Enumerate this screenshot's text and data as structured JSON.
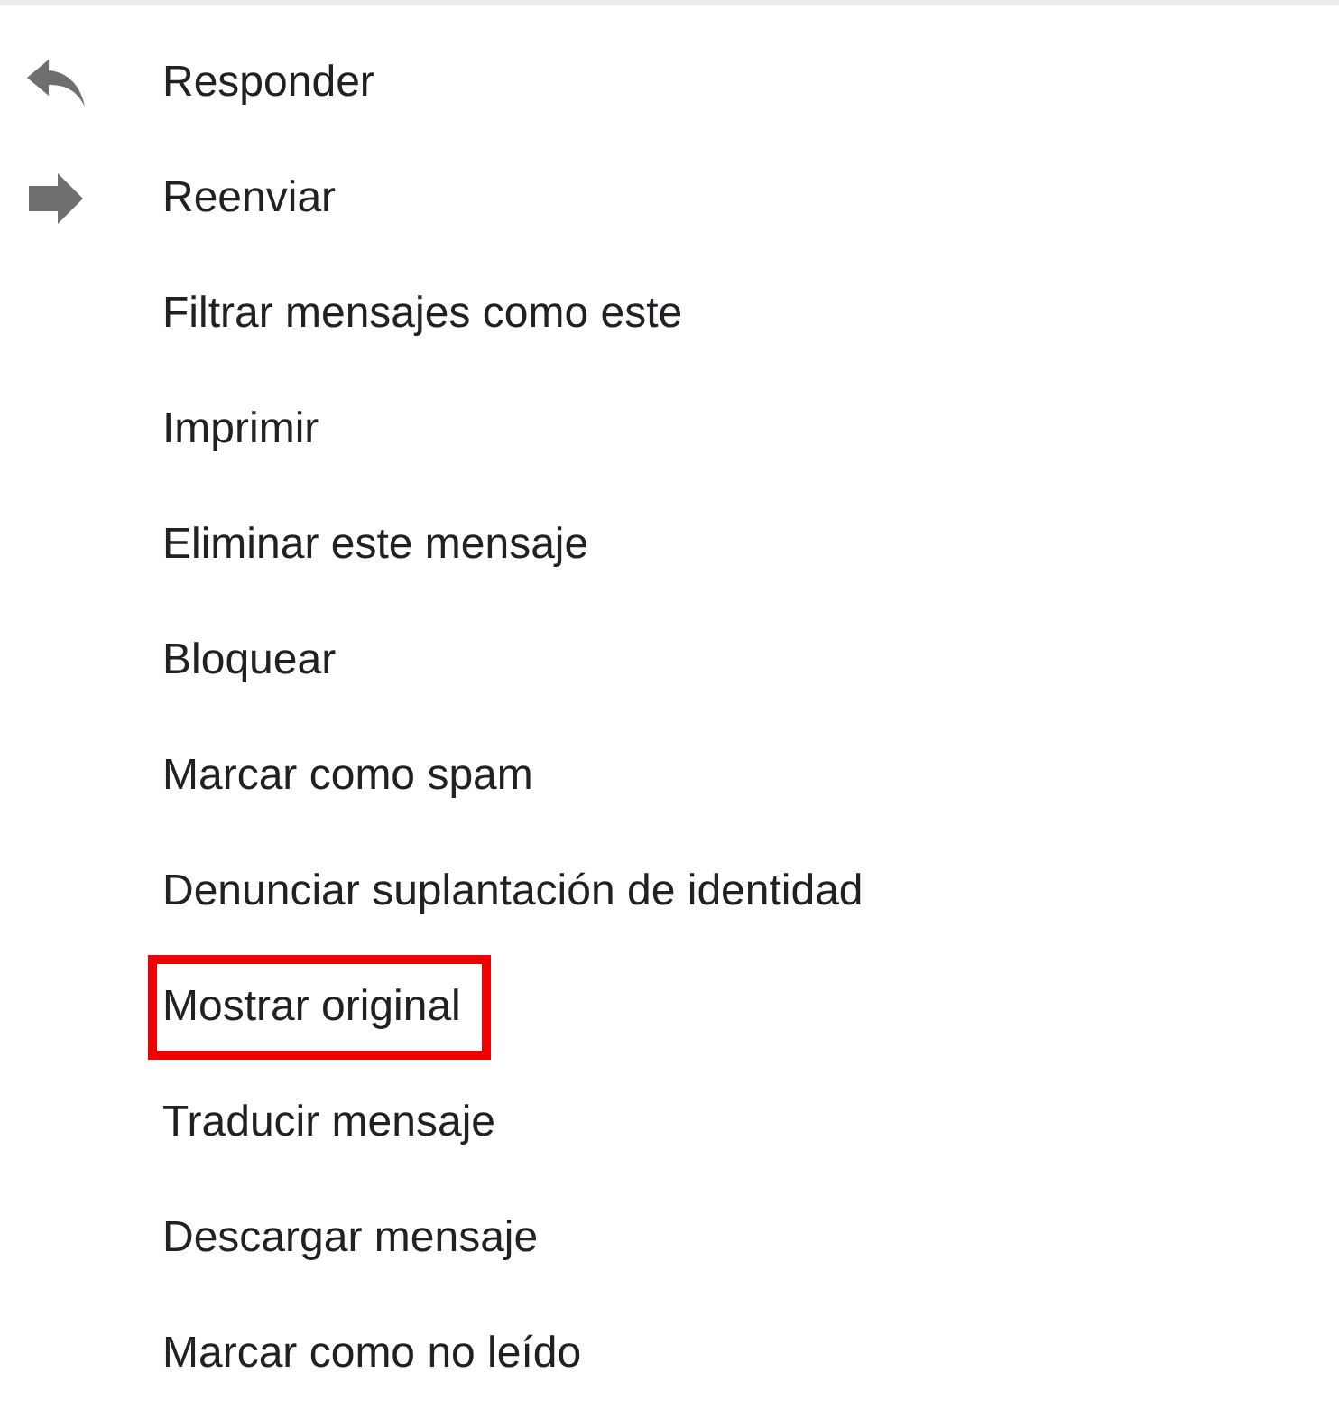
{
  "menu": {
    "items": [
      {
        "label": "Responder",
        "kind": "reply",
        "highlighted": false
      },
      {
        "label": "Reenviar",
        "kind": "forward",
        "highlighted": false
      },
      {
        "label": "Filtrar mensajes como este",
        "kind": "plain",
        "highlighted": false
      },
      {
        "label": "Imprimir",
        "kind": "plain",
        "highlighted": false
      },
      {
        "label": "Eliminar este mensaje",
        "kind": "plain",
        "highlighted": false
      },
      {
        "label": "Bloquear",
        "kind": "plain",
        "highlighted": false
      },
      {
        "label": "Marcar como spam",
        "kind": "plain",
        "highlighted": false
      },
      {
        "label": "Denunciar suplantación de identidad",
        "kind": "plain",
        "highlighted": false
      },
      {
        "label": "Mostrar original",
        "kind": "plain",
        "highlighted": true
      },
      {
        "label": "Traducir mensaje",
        "kind": "plain",
        "highlighted": false
      },
      {
        "label": "Descargar mensaje",
        "kind": "plain",
        "highlighted": false
      },
      {
        "label": "Marcar como no leído",
        "kind": "plain",
        "highlighted": false
      }
    ]
  }
}
